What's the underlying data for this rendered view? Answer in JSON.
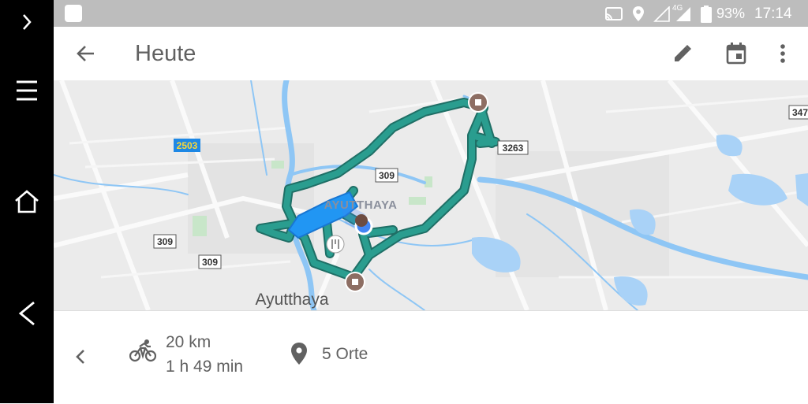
{
  "statusbar": {
    "battery_percent": "93%",
    "time": "17:14",
    "network": "4G"
  },
  "appbar": {
    "title": "Heute"
  },
  "map": {
    "city_label_upper": "AYUTTHAYA",
    "city_label": "Ayutthaya",
    "road_shields": [
      "2503",
      "309",
      "309",
      "309",
      "3263",
      "347"
    ],
    "route_color": "#2a9d8f",
    "place_marker_color": "#8d6e63",
    "current_location_color": "#4285f4"
  },
  "summary": {
    "distance": "20 km",
    "duration": "1 h 49 min",
    "places": "5 Orte"
  },
  "icons": {
    "nav_expand": "chevron-right-icon",
    "nav_menu": "menu-icon",
    "nav_home": "home-icon",
    "nav_back": "back-icon",
    "back": "arrow-left-icon",
    "edit": "pencil-icon",
    "calendar": "calendar-icon",
    "more": "more-vert-icon",
    "prev": "chevron-left-icon",
    "bike": "bicycle-icon",
    "place": "location-pin-icon"
  }
}
